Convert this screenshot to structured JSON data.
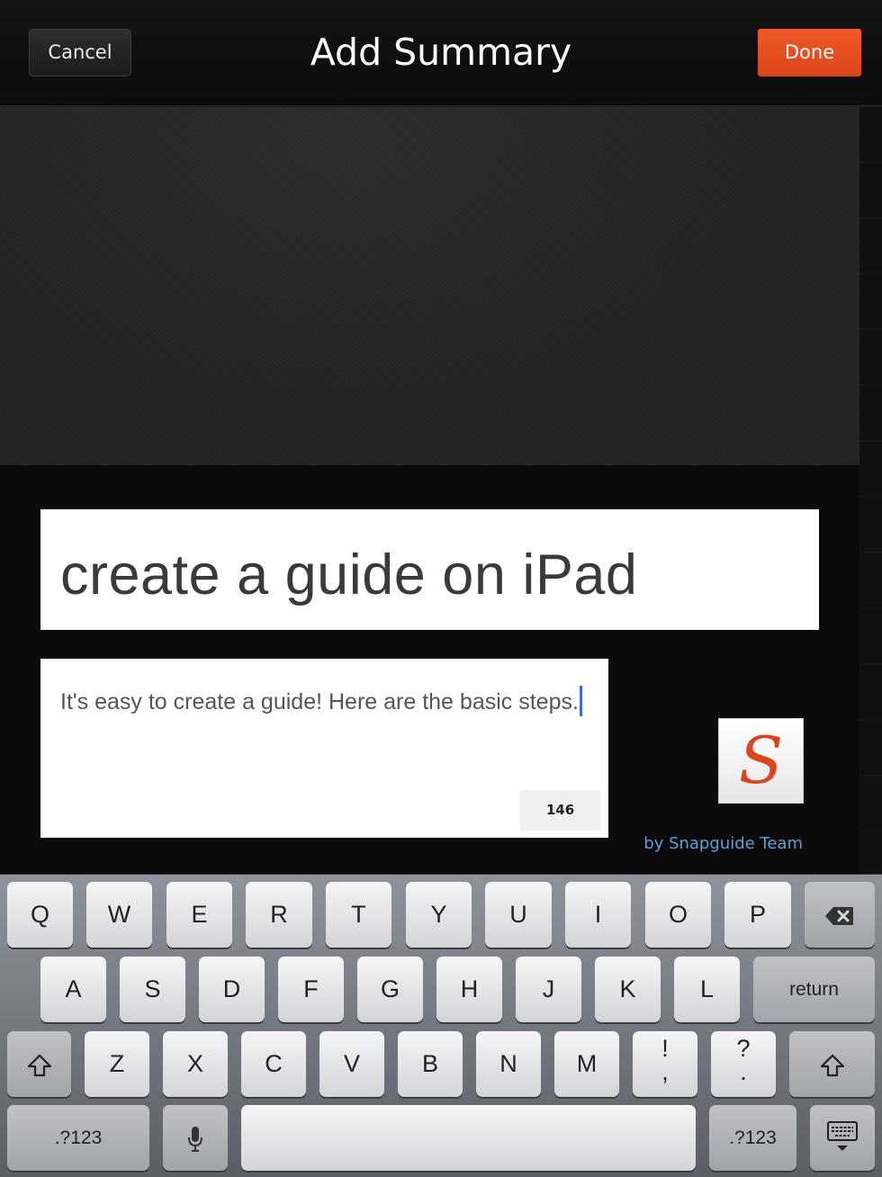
{
  "nav": {
    "cancel_label": "Cancel",
    "title": "Add Summary",
    "done_label": "Done"
  },
  "guide": {
    "title": "create a guide on iPad",
    "summary": "It's easy to create a guide! Here are the basic steps.",
    "char_count": "146",
    "byline": "by Snapguide Team",
    "logo_letter": "S"
  },
  "colors": {
    "accent": "#e8501f",
    "link": "#5f9fd6",
    "cursor": "#3d6ae6"
  },
  "keyboard": {
    "row1": [
      "Q",
      "W",
      "E",
      "R",
      "T",
      "Y",
      "U",
      "I",
      "O",
      "P"
    ],
    "row2": [
      "A",
      "S",
      "D",
      "F",
      "G",
      "H",
      "J",
      "K",
      "L"
    ],
    "row3": [
      "Z",
      "X",
      "C",
      "V",
      "B",
      "N",
      "M"
    ],
    "return_label": "return",
    "exclaim_top": "!",
    "exclaim_bottom": ",",
    "question_top": "?",
    "question_bottom": ".",
    "numbers_label_left": ".?123",
    "numbers_label_right": ".?123",
    "backspace_icon": "backspace-icon",
    "shift_icon": "shift-icon",
    "mic_icon": "microphone-icon",
    "dismiss_icon": "keyboard-dismiss-icon"
  }
}
